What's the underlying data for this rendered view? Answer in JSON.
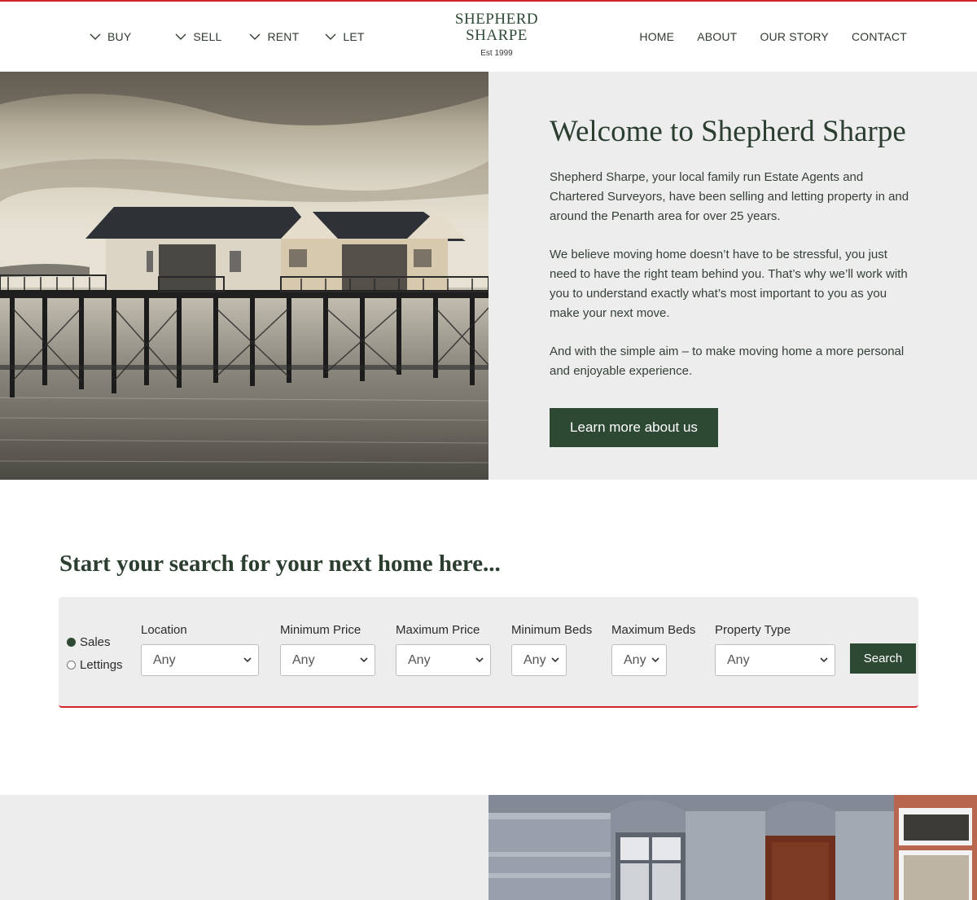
{
  "brand": {
    "name_line1": "SHEPHERD",
    "name_line2": "SHARPE",
    "est": "Est 1999",
    "accent": "#d0252b",
    "primary": "#2d4833"
  },
  "nav_left": [
    {
      "label": "BUY",
      "icon": "chevron-down-icon"
    },
    {
      "label": "SELL",
      "icon": "chevron-down-icon"
    },
    {
      "label": "RENT",
      "icon": "chevron-down-icon"
    },
    {
      "label": "LET",
      "icon": "chevron-down-icon"
    }
  ],
  "nav_right": [
    "HOME",
    "ABOUT",
    "OUR STORY",
    "CONTACT"
  ],
  "hero": {
    "title": "Welcome to Shepherd Sharpe",
    "p1": "Shepherd Sharpe, your local family run Estate Agents and Chartered Surveyors, have been selling and letting property in and around the Penarth area for over 25 years.",
    "p2": "We believe moving home doesn’t have to be stressful, you just need to have the right team behind you. That’s why we’ll work with you to understand exactly what’s most important to you as you make your next move.",
    "p3": "And with the simple aim – to make moving home a more personal and enjoyable experience.",
    "button": "Learn more about us"
  },
  "search": {
    "heading": "Start your search for your next home here...",
    "radios": [
      {
        "label": "Sales",
        "checked": true
      },
      {
        "label": "Lettings",
        "checked": false
      }
    ],
    "fields": [
      {
        "label": "Location",
        "value": "Any"
      },
      {
        "label": "Minimum Price",
        "value": "Any"
      },
      {
        "label": "Maximum Price",
        "value": "Any"
      },
      {
        "label": "Minimum Beds",
        "value": "Any"
      },
      {
        "label": "Maximum Beds",
        "value": "Any"
      },
      {
        "label": "Property Type",
        "value": "Any"
      }
    ],
    "button": "Search"
  }
}
